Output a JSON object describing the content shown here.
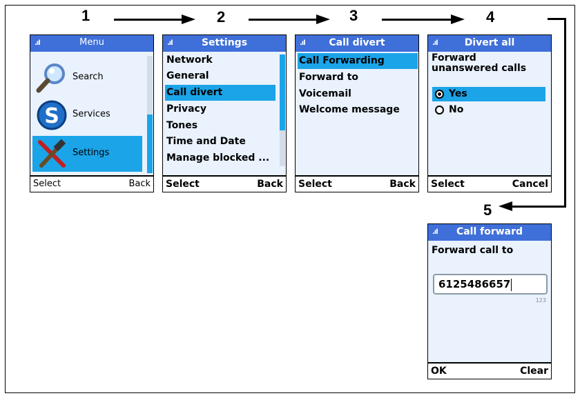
{
  "steps": [
    "1",
    "2",
    "3",
    "4",
    "5"
  ],
  "screen1": {
    "title": "Menu",
    "signal": ".ıl",
    "items": [
      {
        "label": "Search",
        "icon": "magnifier-icon"
      },
      {
        "label": "Services",
        "icon": "skype-icon"
      },
      {
        "label": "Settings",
        "icon": "tools-icon"
      }
    ],
    "softkey_left": "Select",
    "softkey_right": "Back"
  },
  "screen2": {
    "title": "Settings",
    "signal": ".ıl",
    "items": [
      "Network",
      "General",
      "Call divert",
      "Privacy",
      "Tones",
      "Time and Date",
      "Manage blocked ..."
    ],
    "selected": "Call divert",
    "softkey_left": "Select",
    "softkey_right": "Back"
  },
  "screen3": {
    "title": "Call divert",
    "signal": ".ıl",
    "items": [
      "Call Forwarding",
      "Forward to",
      "Voicemail",
      "Welcome message"
    ],
    "selected": "Call Forwarding",
    "softkey_left": "Select",
    "softkey_right": "Back"
  },
  "screen4": {
    "title": "Divert all",
    "signal": ".ıl",
    "question_line1": "Forward",
    "question_line2": "unanswered calls",
    "options": [
      "Yes",
      "No"
    ],
    "selected": "Yes",
    "softkey_left": "Select",
    "softkey_right": "Cancel"
  },
  "screen5": {
    "title": "Call forward",
    "signal": ".ıl",
    "label": "Forward call to",
    "input_value": "6125486657",
    "input_mode": "123",
    "softkey_left": "OK",
    "softkey_right": "Clear"
  },
  "colors": {
    "titlebar": "#3f6fd8",
    "highlight": "#1ba4e8",
    "screen_bg": "#e9f2fd"
  }
}
